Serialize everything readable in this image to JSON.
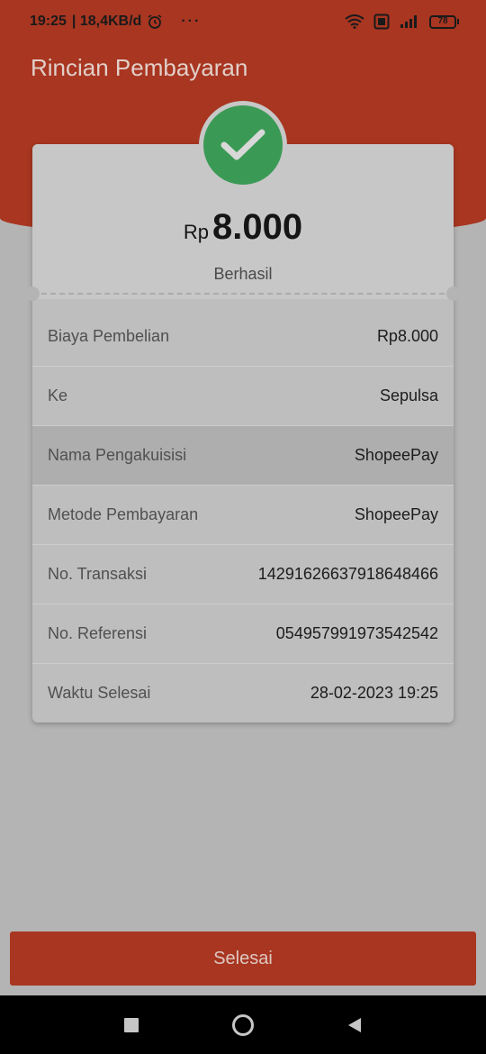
{
  "status_bar": {
    "time": "19:25",
    "network_speed": "| 18,4KB/d",
    "more": "···",
    "battery": "78",
    "icons": [
      "alarm-icon",
      "wifi-icon",
      "volte-icon",
      "signal-icon",
      "battery-icon"
    ]
  },
  "header": {
    "title": "Rincian Pembayaran"
  },
  "summary": {
    "currency": "Rp",
    "amount": "8.000",
    "status": "Berhasil",
    "status_icon": "checkmark-icon"
  },
  "details": [
    {
      "label": "Biaya Pembelian",
      "value": "Rp8.000"
    },
    {
      "label": "Ke",
      "value": "Sepulsa"
    },
    {
      "label": "Nama Pengakuisisi",
      "value": "ShopeePay"
    },
    {
      "label": "Metode Pembayaran",
      "value": "ShopeePay"
    },
    {
      "label": "No. Transaksi",
      "value": "1429162663791864846​6"
    },
    {
      "label": "No. Referensi",
      "value": "054957991973542542"
    },
    {
      "label": "Waktu Selesai",
      "value": "28-02-2023 19:25"
    }
  ],
  "footer": {
    "done_label": "Selesai"
  },
  "colors": {
    "brand": "#a83621",
    "success": "#3a9a55",
    "overlay_bg": "#b4b4b4"
  }
}
